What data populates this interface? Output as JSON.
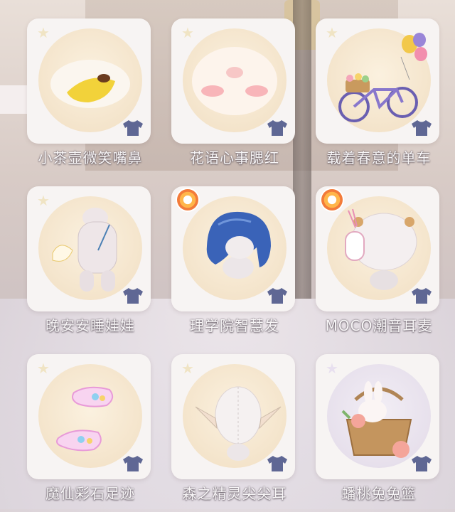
{
  "items": [
    {
      "name": "小茶壶微笑嘴鼻",
      "category_icon": "shirt-icon",
      "corner_icon": "star-icon",
      "art": "smiling-mouth-nose"
    },
    {
      "name": "花语心事腮红",
      "category_icon": "shirt-icon",
      "corner_icon": "star-icon",
      "art": "blush"
    },
    {
      "name": "载着春意的单车",
      "category_icon": "shirt-icon",
      "corner_icon": "star-icon",
      "art": "bicycle-with-balloons"
    },
    {
      "name": "晚安安睡娃娃",
      "category_icon": "shirt-icon",
      "corner_icon": "star-icon",
      "art": "plush-doll"
    },
    {
      "name": "理学院智慧发",
      "category_icon": "shirt-icon",
      "corner_icon": "orange-badge-icon",
      "art": "blue-hair"
    },
    {
      "name": "MOCO潮音耳麦",
      "category_icon": "shirt-icon",
      "corner_icon": "orange-badge-icon",
      "art": "headphones"
    },
    {
      "name": "魔仙彩石足迹",
      "category_icon": "shirt-icon",
      "corner_icon": "star-icon",
      "art": "rainbow-footprints"
    },
    {
      "name": "森之精灵尖尖耳",
      "category_icon": "shirt-icon",
      "corner_icon": "star-icon",
      "art": "elf-ears"
    },
    {
      "name": "蟠桃兔兔篮",
      "category_icon": "shirt-icon",
      "corner_icon": "star-icon",
      "art": "bunny-peach-basket"
    }
  ],
  "colors": {
    "card_bg": "#f7f4f3",
    "circle_warm": "#f4e4cb",
    "circle_lilac": "#e7e0ec",
    "shirt_icon": "#5f6794",
    "badge_orange": "#f37b3a"
  }
}
